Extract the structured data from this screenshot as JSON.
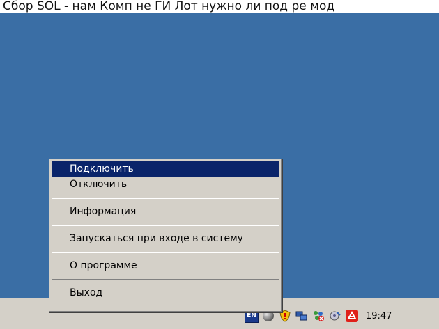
{
  "caption": "Сбор SOL - нам Комп не ГИ Лот нужно ли под ре мод",
  "menu": {
    "items": [
      {
        "label": "Подключить",
        "highlighted": true
      },
      {
        "label": "Отключить"
      },
      {
        "label": "Информация"
      },
      {
        "label": "Запускаться при входе в систему"
      },
      {
        "label": "О программе"
      },
      {
        "label": "Выход"
      }
    ]
  },
  "tray": {
    "language": "EN",
    "icons": [
      "gray-sphere-icon",
      "shield-icon",
      "network-connection-icon",
      "network-error-icon",
      "hardware-icon",
      "antivirus-umbrella-icon"
    ],
    "clock": "19:47"
  },
  "colors": {
    "desktop": "#3a6ea5",
    "menu_bg": "#d4d0c8",
    "highlight": "#0a246a"
  }
}
